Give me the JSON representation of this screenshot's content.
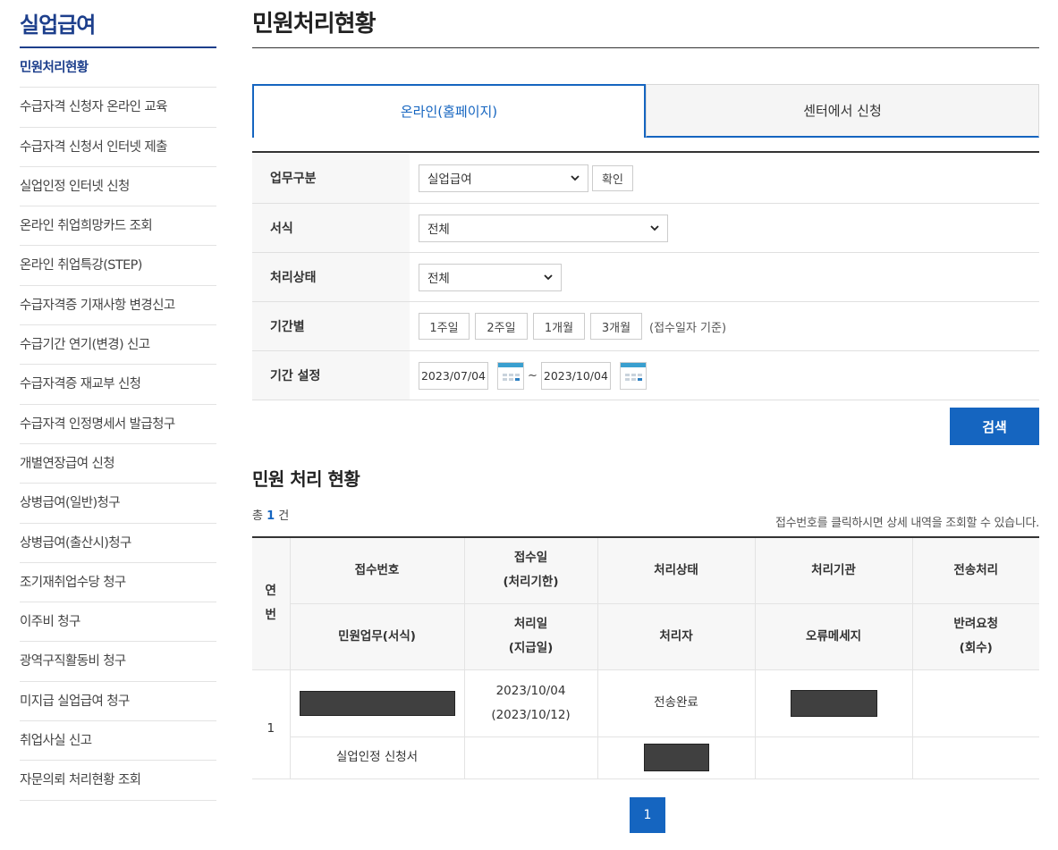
{
  "sidebar": {
    "title": "실업급여",
    "items": [
      {
        "label": "민원처리현황",
        "active": true
      },
      {
        "label": "수급자격 신청자 온라인 교육"
      },
      {
        "label": "수급자격 신청서 인터넷 제출"
      },
      {
        "label": "실업인정 인터넷 신청"
      },
      {
        "label": "온라인 취업희망카드 조회"
      },
      {
        "label": "온라인 취업특강(STEP)"
      },
      {
        "label": "수급자격증 기재사항 변경신고"
      },
      {
        "label": "수급기간 연기(변경) 신고"
      },
      {
        "label": "수급자격증 재교부 신청"
      },
      {
        "label": "수급자격 인정명세서 발급청구"
      },
      {
        "label": "개별연장급여 신청"
      },
      {
        "label": "상병급여(일반)청구"
      },
      {
        "label": "상병급여(출산시)청구"
      },
      {
        "label": "조기재취업수당 청구"
      },
      {
        "label": "이주비 청구"
      },
      {
        "label": "광역구직활동비 청구"
      },
      {
        "label": "미지급 실업급여 청구"
      },
      {
        "label": "취업사실 신고"
      },
      {
        "label": "자문의뢰 처리현황 조회"
      }
    ]
  },
  "page": {
    "title": "민원처리현황"
  },
  "tabs": [
    {
      "label": "온라인(홈페이지)",
      "active": true
    },
    {
      "label": "센터에서 신청",
      "active": false
    }
  ],
  "form": {
    "task_type": {
      "label": "업무구분",
      "value": "실업급여",
      "confirm_label": "확인"
    },
    "format": {
      "label": "서식",
      "value": "전체"
    },
    "status": {
      "label": "처리상태",
      "value": "전체"
    },
    "period": {
      "label": "기간별",
      "buttons": [
        "1주일",
        "2주일",
        "1개월",
        "3개월"
      ],
      "note": "(접수일자 기준)"
    },
    "range": {
      "label": "기간 설정",
      "start": "2023/07/04",
      "separator": "~",
      "end": "2023/10/04"
    }
  },
  "search": {
    "label": "검색"
  },
  "results": {
    "section_title": "민원 처리 현황",
    "count_prefix": "총",
    "count": "1",
    "count_suffix": "건",
    "hint": "접수번호를 클릭하시면 상세 내역을 조회할 수 있습니다.",
    "headers": {
      "no_top": "연",
      "no_bottom": "번",
      "receipt_no": "접수번호",
      "receipt_date_1": "접수일",
      "receipt_date_2": "(처리기한)",
      "status": "처리상태",
      "agency": "처리기관",
      "transfer": "전송처리",
      "task": "민원업무(서식)",
      "proc_date_1": "처리일",
      "proc_date_2": "(지급일)",
      "handler": "처리자",
      "error": "오류메세지",
      "return_1": "반려요청",
      "return_2": "(회수)"
    },
    "rows": [
      {
        "no": "1",
        "receipt_date": "2023/10/04",
        "deadline": "(2023/10/12)",
        "status": "전송완료",
        "task": "실업인정 신청서"
      }
    ]
  },
  "pagination": {
    "current": "1"
  },
  "colors": {
    "primary": "#1565c0",
    "sidebar_title": "#1d3f8c",
    "redaction": "#404040"
  }
}
